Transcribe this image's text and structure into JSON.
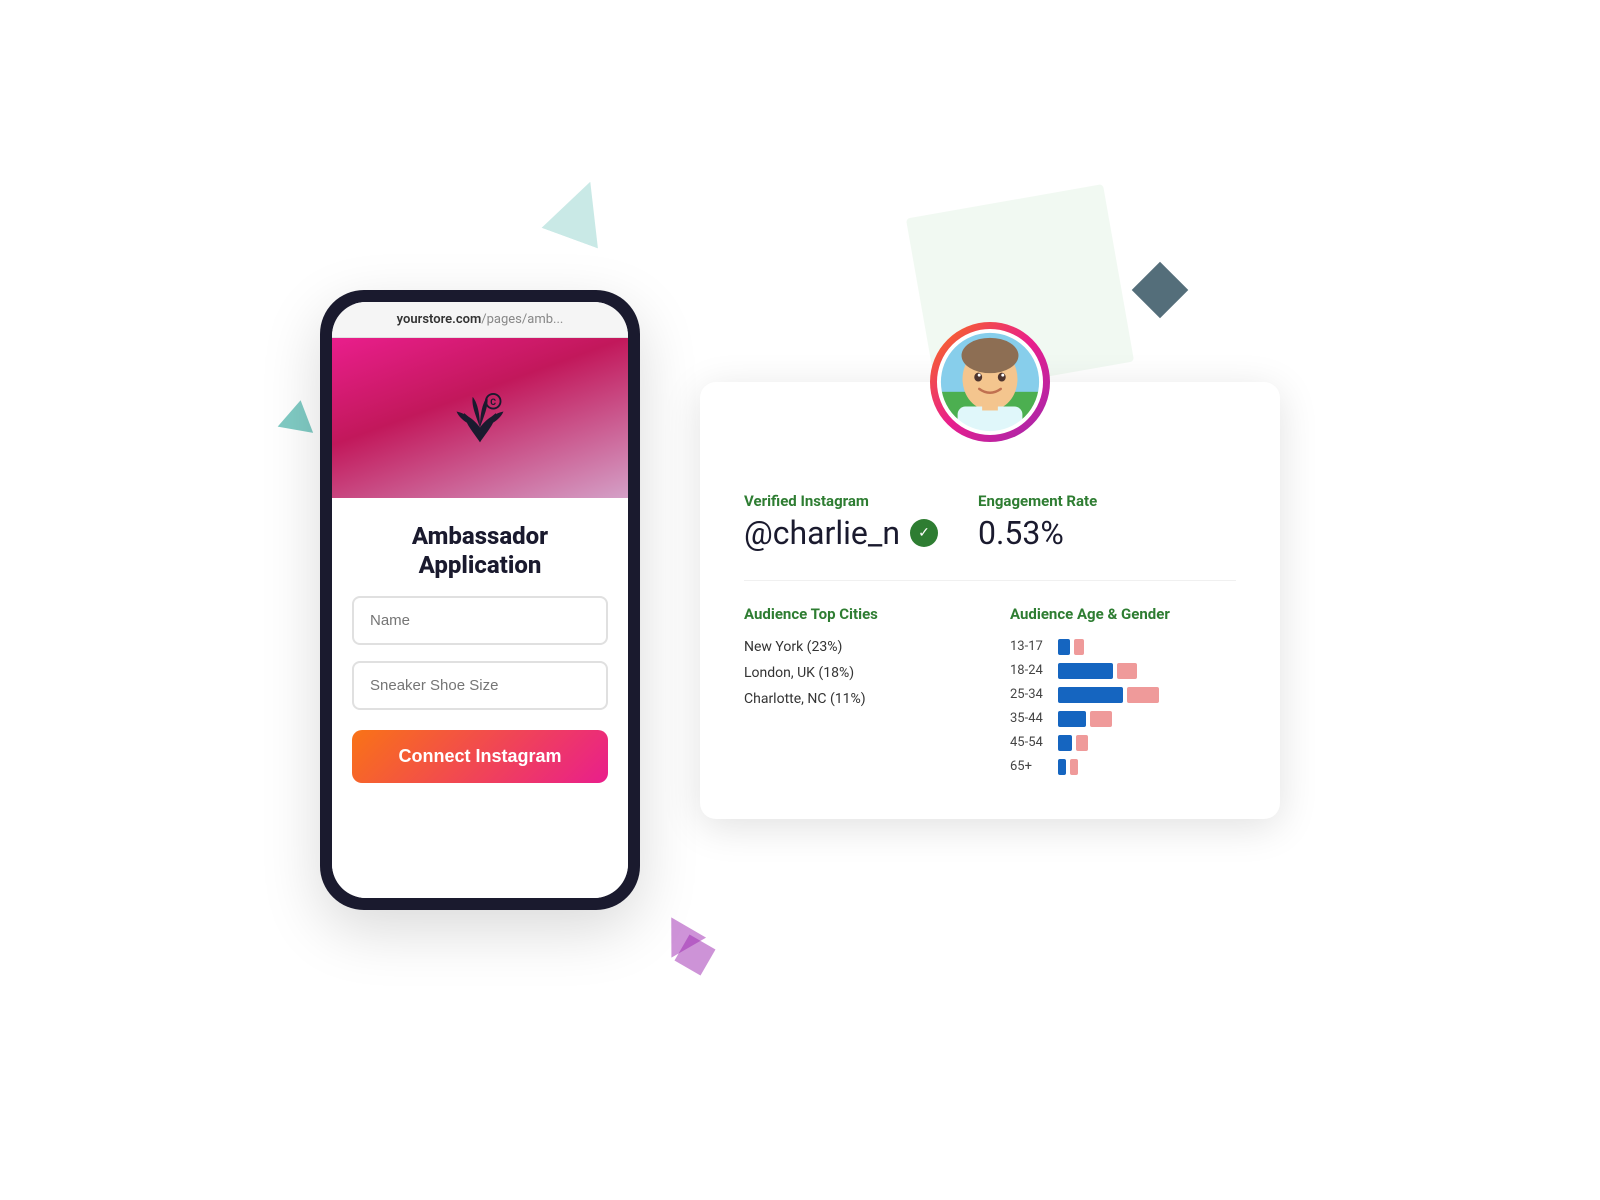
{
  "scene": {
    "phone": {
      "url_bold": "yourstore.com",
      "url_light": "/pages/amb...",
      "title_line1": "Ambassador",
      "title_line2": "Application",
      "name_placeholder": "Name",
      "shoe_placeholder": "Sneaker Shoe Size",
      "connect_btn": "Connect Instagram"
    },
    "card": {
      "instagram_label": "Verified Instagram",
      "instagram_handle": "@charlie_n",
      "engagement_label": "Engagement Rate",
      "engagement_value": "0.53%",
      "audience_cities_header": "Audience Top Cities",
      "audience_age_header": "Audience Age & Gender",
      "cities": [
        {
          "name": "New York (23%)"
        },
        {
          "name": "London, UK (18%)"
        },
        {
          "name": "Charlotte, NC (11%)"
        }
      ],
      "age_groups": [
        {
          "label": "13-17",
          "male": 12,
          "female": 10
        },
        {
          "label": "18-24",
          "male": 55,
          "female": 20
        },
        {
          "label": "25-34",
          "male": 65,
          "female": 32
        },
        {
          "label": "35-44",
          "male": 28,
          "female": 22
        },
        {
          "label": "45-54",
          "male": 14,
          "female": 12
        },
        {
          "label": "65+",
          "male": 8,
          "female": 8
        }
      ]
    }
  }
}
